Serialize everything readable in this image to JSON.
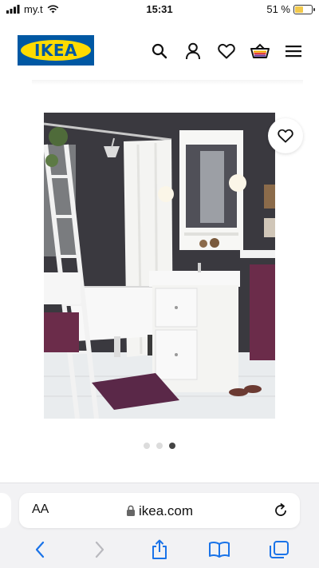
{
  "status_bar": {
    "carrier": "my.t",
    "time": "15:31",
    "battery_text": "51 %",
    "battery_level": 0.51,
    "icons": [
      "signal-icon",
      "wifi-icon",
      "battery-icon"
    ]
  },
  "header": {
    "logo_text": "IKEA",
    "brand_colors": {
      "blue": "#0058a3",
      "yellow": "#ffdb00"
    },
    "icons": [
      "search-icon",
      "user-icon",
      "heart-icon",
      "basket-icon",
      "menu-icon"
    ],
    "basket_stripe_colors": [
      "#f2a900",
      "#e23c3c",
      "#6a3c9e"
    ]
  },
  "product": {
    "image_subject": "bathroom-scene",
    "favourite_icon": "heart-icon"
  },
  "carousel": {
    "dot_count": 3,
    "active_index": 2
  },
  "safari": {
    "text_size_label": "AA",
    "url": "ikea.com",
    "icons": [
      "lock-icon",
      "reload-icon",
      "back-icon",
      "forward-icon",
      "share-icon",
      "bookmarks-icon",
      "tabs-icon"
    ]
  }
}
